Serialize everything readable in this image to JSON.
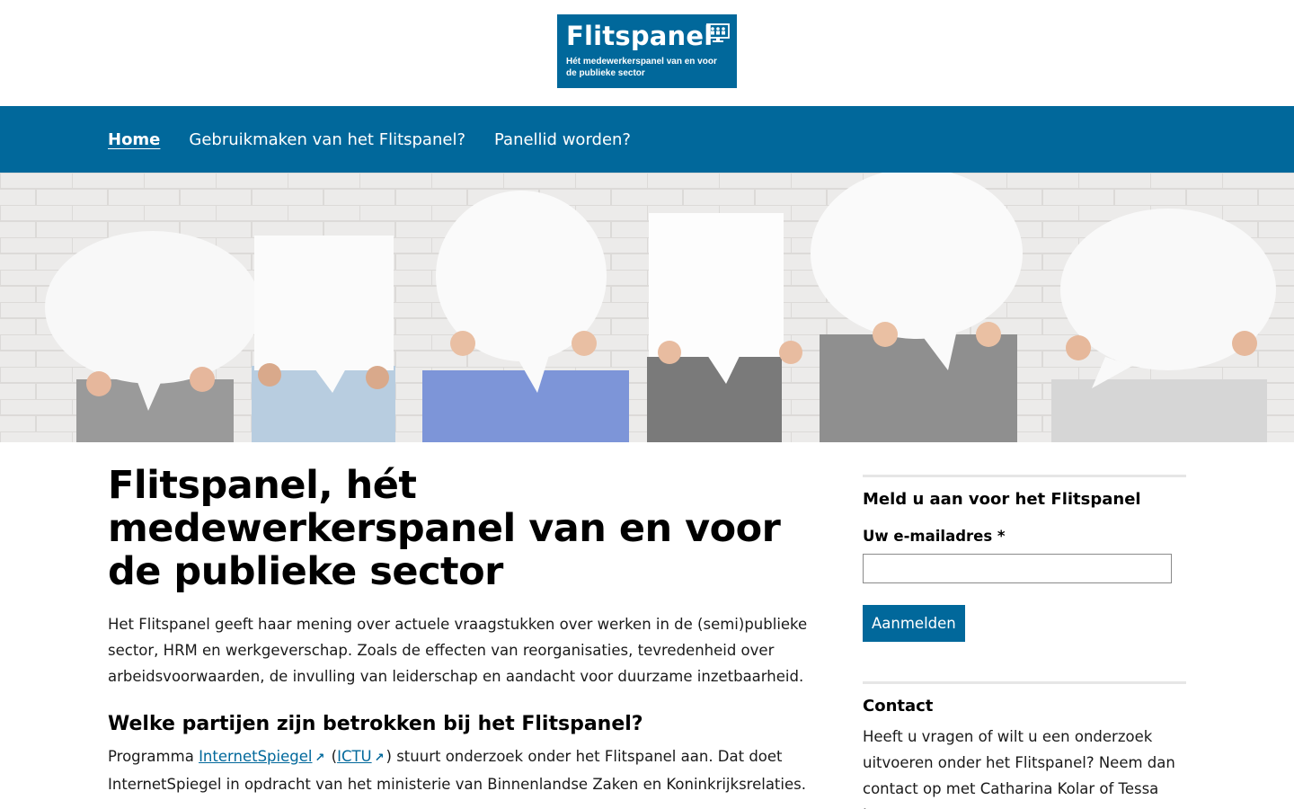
{
  "logo": {
    "title": "Flitspanel",
    "subtitle_line1": "Hét medewerkerspanel van en voor",
    "subtitle_line2": "de publieke sector"
  },
  "nav": {
    "items": [
      {
        "label": "Home",
        "active": true
      },
      {
        "label": "Gebruikmaken van het Flitspanel?",
        "active": false
      },
      {
        "label": "Panellid worden?",
        "active": false
      }
    ]
  },
  "main": {
    "title": "Flitspanel, hét medewerkerspanel van en voor de publieke sector",
    "intro": "Het Flitspanel geeft haar mening over actuele vraagstukken over werken in de (semi)publieke sector, HRM en werkgeverschap. Zoals de effecten van reorganisaties, tevredenheid over arbeidsvoorwaarden, de invulling van leiderschap en aandacht voor duurzame inzetbaarheid.",
    "section_title": "Welke partijen zijn betrokken bij het Flitspanel?",
    "section_text_prefix": "Programma",
    "link1": "InternetSpiegel",
    "paren_open": "(",
    "link2": "ICTU",
    "section_text_suffix": ") stuurt onderzoek onder het Flitspanel aan. Dat doet InternetSpiegel in opdracht van het ministerie van Binnenlandse Zaken en Koninkrijksrelaties."
  },
  "sidebar": {
    "signup_title": "Meld u aan voor het Flitspanel",
    "email_label": "Uw e-mailadres *",
    "email_value": "",
    "submit_label": "Aanmelden",
    "contact_title": "Contact",
    "contact_text": "Heeft u vragen of wilt u een onderzoek uitvoeren onder het Flitspanel? Neem dan contact op met Catharina Kolar of Tessa Janssen"
  },
  "colors": {
    "brand": "#01689b",
    "link": "#01689b",
    "divider": "#e6e6e6"
  }
}
